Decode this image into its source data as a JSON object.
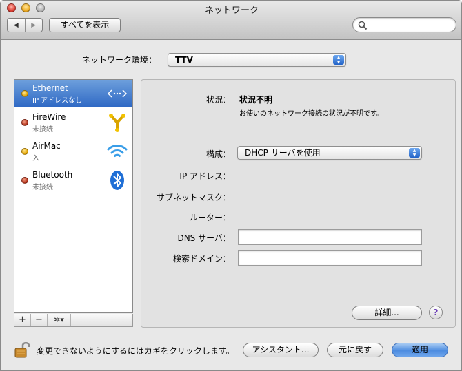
{
  "window": {
    "title": "ネットワーク"
  },
  "toolbar": {
    "back": "◀",
    "forward": "▶",
    "show_all_label": "すべてを表示",
    "search_placeholder": ""
  },
  "location": {
    "label": "ネットワーク環境：",
    "value": "TTV"
  },
  "services": [
    {
      "name": "Ethernet",
      "status": "IP アドレスなし",
      "status_color": "yellow",
      "icon": "ethernet-icon",
      "selected": true
    },
    {
      "name": "FireWire",
      "status": "未接続",
      "status_color": "red",
      "icon": "firewire-icon",
      "selected": false
    },
    {
      "name": "AirMac",
      "status": "入",
      "status_color": "yellow",
      "icon": "airport-icon",
      "selected": false
    },
    {
      "name": "Bluetooth",
      "status": "未接続",
      "status_color": "red",
      "icon": "bluetooth-icon",
      "selected": false
    }
  ],
  "sidebar_controls": {
    "add": "+",
    "remove": "−",
    "action": "✲▾"
  },
  "detail": {
    "status_label": "状況：",
    "status_value": "状況不明",
    "status_desc": "お使いのネットワーク接続の状況が不明です。",
    "config_label": "構成：",
    "config_value": "DHCP サーバを使用",
    "ip_label": "IP アドレス：",
    "subnet_label": "サブネットマスク：",
    "router_label": "ルーター：",
    "dns_label": "DNS サーバ：",
    "dns_value": "",
    "search_domain_label": "検索ドメイン：",
    "search_domain_value": "",
    "advanced_button": "詳細...",
    "help_button": "?"
  },
  "footer": {
    "lock_text": "変更できないようにするにはカギをクリックします。",
    "assistant_button": "アシスタント...",
    "revert_button": "元に戻す",
    "apply_button": "適用"
  },
  "colors": {
    "selection": "#3f78cf",
    "default_button": "#5a96e4"
  }
}
